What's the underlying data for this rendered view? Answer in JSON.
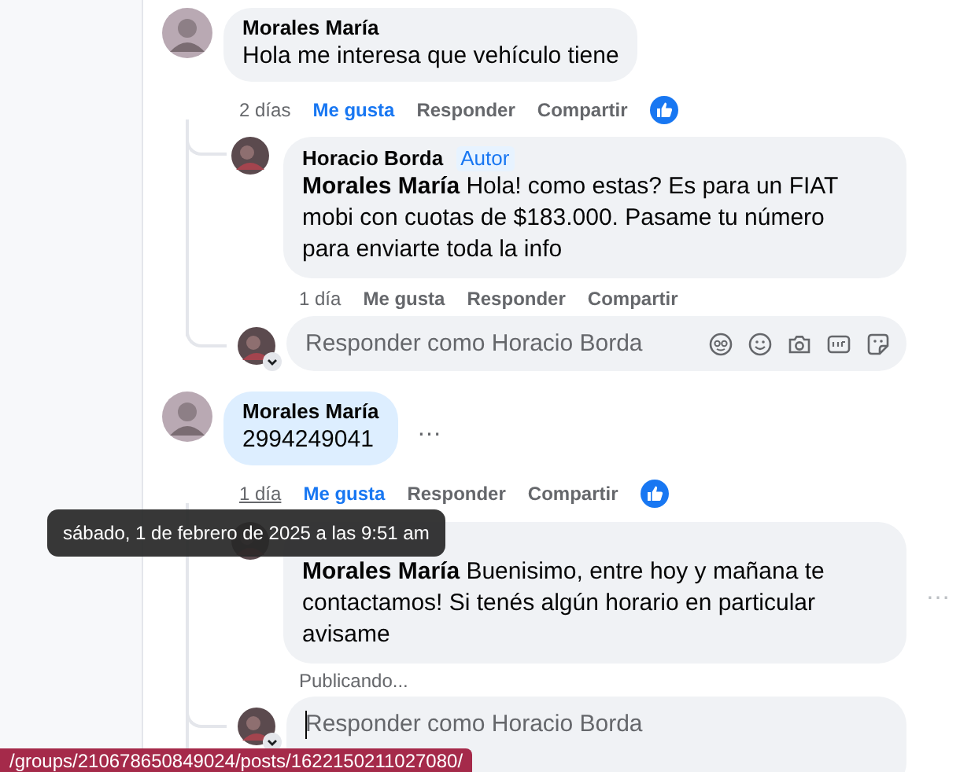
{
  "comments": [
    {
      "author": "Morales María",
      "text": "Hola me interesa que vehículo tiene",
      "highlighted": false,
      "time": "2 días",
      "time_hovered": false,
      "liked": true,
      "actions": [
        "Me gusta",
        "Responder",
        "Compartir"
      ],
      "reaction_shown": true,
      "replies": [
        {
          "author": "Horacio Borda",
          "badge": "Autor",
          "text": "**Morales María** Hola! como estas? Es para un FIAT mobi con cuotas de $183.000. Pasame tu número para enviarte toda la info",
          "time": "1 día",
          "liked": false,
          "actions": [
            "Me gusta",
            "Responder",
            "Compartir"
          ]
        }
      ],
      "composer": {
        "placeholder": "Responder como Horacio Borda",
        "focused": false,
        "icons": true
      }
    },
    {
      "author": "Morales María",
      "text": "2994249041",
      "highlighted": true,
      "more": "…",
      "time": "1 día",
      "time_hovered": true,
      "liked": true,
      "actions": [
        "Me gusta",
        "Responder",
        "Compartir"
      ],
      "reaction_shown": true,
      "replies": [
        {
          "text": "**Morales María** Buenisimo, entre hoy y mañana te contactamos! Si tenés algún horario en particular avisame",
          "more": "…",
          "status": "Publicando..."
        }
      ],
      "composer": {
        "placeholder": "Responder como Horacio Borda",
        "focused": true,
        "icons": false
      }
    }
  ],
  "tooltip": {
    "text": "sábado, 1 de febrero de 2025 a las 9:51 am"
  },
  "status_bar": {
    "url": "/groups/210678650849024/posts/1622150211027080/"
  }
}
